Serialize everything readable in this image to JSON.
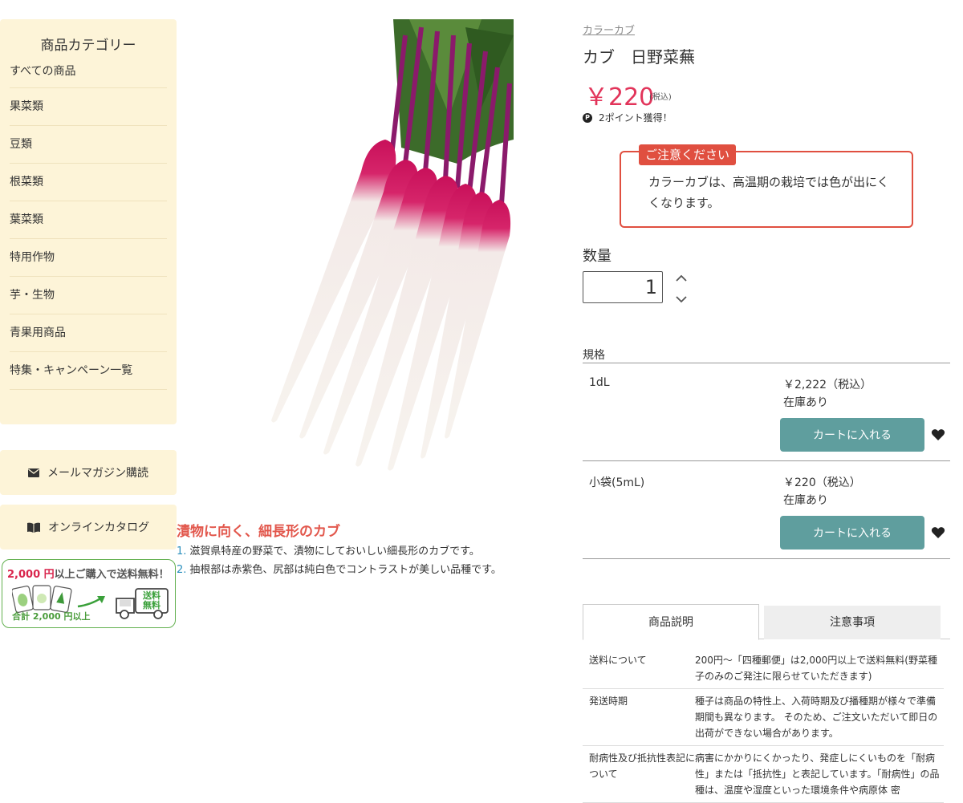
{
  "sidebar": {
    "title": "商品カテゴリー",
    "items": [
      {
        "label": "すべての商品"
      },
      {
        "label": "果菜類"
      },
      {
        "label": "豆類"
      },
      {
        "label": "根菜類"
      },
      {
        "label": "葉菜類"
      },
      {
        "label": "特用作物"
      },
      {
        "label": "芋・生物"
      },
      {
        "label": "青果用商品"
      },
      {
        "label": "特集・キャンペーン一覧"
      }
    ],
    "newsletter_label": "メールマガジン購読",
    "catalog_label": "オンラインカタログ",
    "banner": {
      "amount": "2,000 円",
      "headline_rest": "以上ご購入で送料無料！",
      "sub": "合計 2,000 円以上",
      "truck_text_1": "送料",
      "truck_text_2": "無料"
    }
  },
  "product": {
    "category": "カラーカブ",
    "name": "カブ　日野菜蕪",
    "price": "￥220",
    "tax_note": "(税込)",
    "points": "2ポイント獲得！",
    "notice_label": "ご注意ください",
    "notice_text": "カラーカブは、高温期の栽培では色が出にくくなります。",
    "qty_label": "数量",
    "qty_value": "1",
    "spec_label": "規格",
    "variants": [
      {
        "name": "1dL",
        "price": "￥2,222（税込）",
        "stock": "在庫あり",
        "cart_label": "カートに入れる"
      },
      {
        "name": "小袋(5mL)",
        "price": "￥220（税込）",
        "stock": "在庫あり",
        "cart_label": "カートに入れる"
      }
    ]
  },
  "features": {
    "title": "漬物に向く、細長形のカブ",
    "items": [
      {
        "num": "1.",
        "text": "滋賀県特産の野菜で、漬物にしておいしい細長形のカブです。"
      },
      {
        "num": "2.",
        "text": "抽根部は赤紫色、尻部は純白色でコントラストが美しい品種です。"
      }
    ]
  },
  "tabs": [
    {
      "label": "商品説明"
    },
    {
      "label": "注意事項"
    }
  ],
  "info": [
    {
      "key": "送料について",
      "value": "200円〜「四種郵便」は2,000円以上で送料無料(野菜種子のみのご発注に限らせていただきます)"
    },
    {
      "key": "発送時期",
      "value": "種子は商品の特性上、入荷時期及び播種期が様々で準備期間も異なります。 そのため、ご注文いただいて即日の出荷ができない場合があります。"
    },
    {
      "key": "耐病性及び抵抗性表記について",
      "value": "病害にかかりにくかったり、発症しにくいものを「耐病性」または「抵抗性」と表記しています。「耐病性」の品種は、温度や湿度といった環境条件や病原体 密"
    }
  ],
  "colors": {
    "sidebar_bg": "#fdf4d8",
    "price": "#e2345a",
    "notice": "#e04f40",
    "cart_button": "#5f9e9e",
    "feature_title": "#e2574c"
  },
  "icons": [
    "envelope-icon",
    "book-icon",
    "point-icon",
    "chevron-up-icon",
    "chevron-down-icon",
    "heart-icon"
  ]
}
